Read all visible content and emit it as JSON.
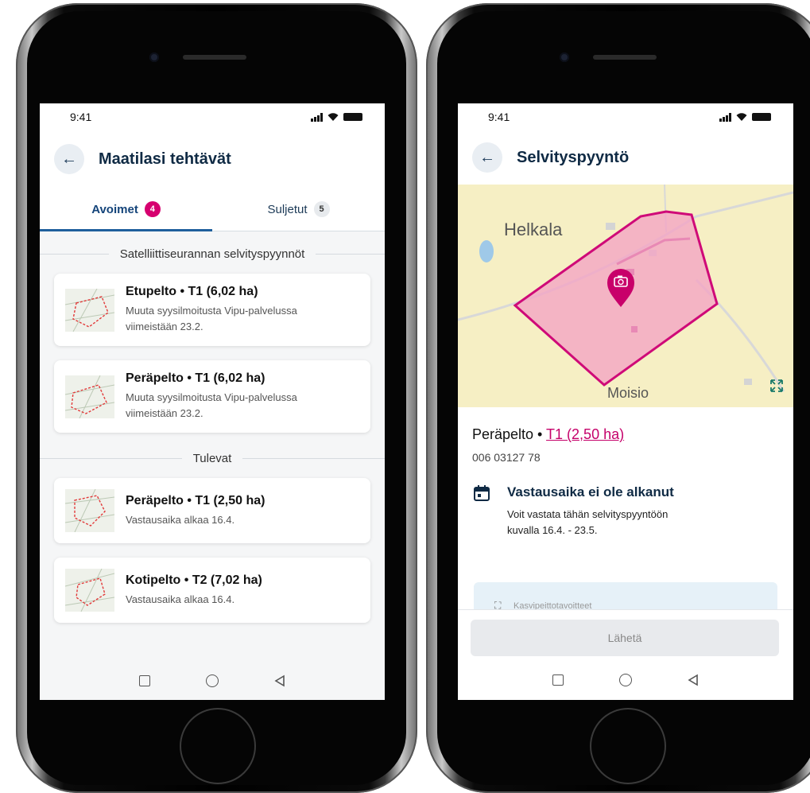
{
  "colors": {
    "accent_pink": "#d6006f",
    "primary_blue": "#1f5f9c",
    "dark_navy": "#0f2a44",
    "map_bg": "#f6efc4"
  },
  "left_phone": {
    "status_time": "9:41",
    "title": "Maatilasi tehtävät",
    "back_icon": "arrow-left-icon",
    "tabs": [
      {
        "label": "Avoimet",
        "badge": "4"
      },
      {
        "label": "Suljetut",
        "badge": "5"
      }
    ],
    "section_satellite": "Satelliittiseurannan selvityspyynnöt",
    "section_upcoming": "Tulevat",
    "open_items": [
      {
        "title": "Etupelto • T1 (6,02 ha)",
        "line1": "Muuta syysilmoitusta Vipu-palvelussa",
        "line2": "viimeistään 23.2."
      },
      {
        "title": "Peräpelto • T1 (6,02 ha)",
        "line1": "Muuta syysilmoitusta Vipu-palvelussa",
        "line2": "viimeistään 23.2."
      }
    ],
    "upcoming_items": [
      {
        "title": "Peräpelto • T1 (2,50 ha)",
        "line1": "Vastausaika alkaa 16.4."
      },
      {
        "title": "Kotipelto • T2 (7,02 ha)",
        "line1": "Vastausaika alkaa 16.4."
      }
    ]
  },
  "right_phone": {
    "status_time": "9:41",
    "title": "Selvityspyyntö",
    "map": {
      "label_north": "Helkala",
      "label_south": "Moisio",
      "expand_icon": "expand-icon",
      "marker_icon": "camera-icon"
    },
    "field_name": "Peräpelto •",
    "field_link": "T1 (2,50 ha)",
    "field_id": "006 03127 78",
    "notice_title": "Vastausaika ei ole alkanut",
    "notice_line1": "Voit vastata tähän selvityspyyntöön",
    "notice_line2": "kuvalla 16.4. - 23.5.",
    "info_text": "Kasvipeittotavoitteet",
    "send_label": "Lähetä"
  }
}
